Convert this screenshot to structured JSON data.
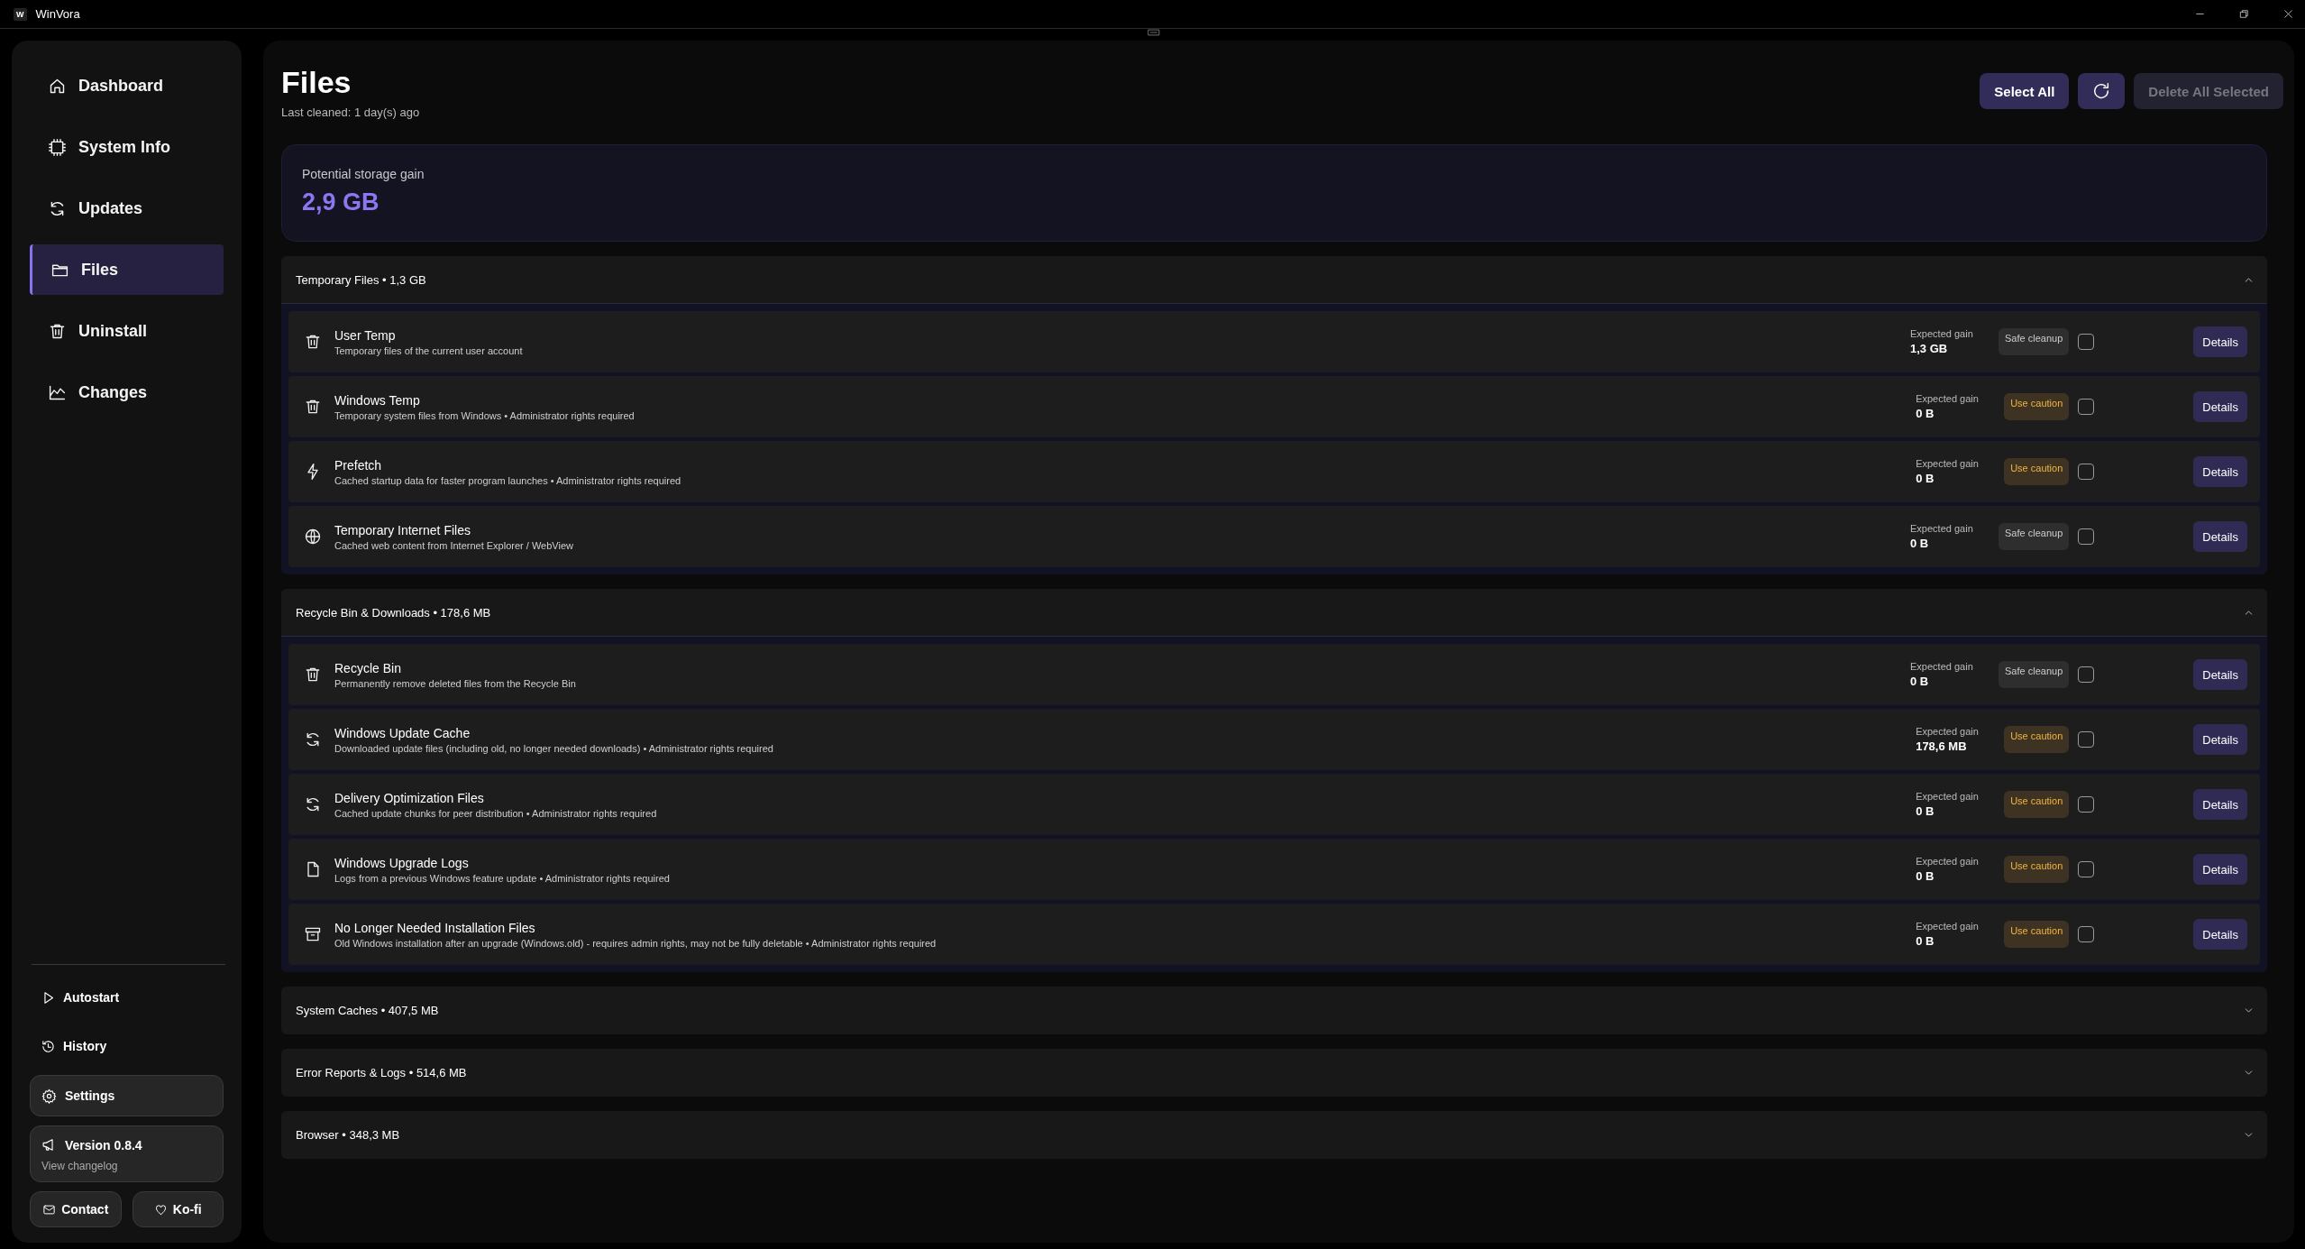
{
  "window": {
    "logo": "W",
    "title": "WinVora"
  },
  "sidebar": {
    "nav": [
      {
        "label": "Dashboard",
        "selected": false
      },
      {
        "label": "System Info",
        "selected": false
      },
      {
        "label": "Updates",
        "selected": false
      },
      {
        "label": "Files",
        "selected": true
      },
      {
        "label": "Uninstall",
        "selected": false
      },
      {
        "label": "Changes",
        "selected": false
      }
    ],
    "footer_links": [
      {
        "label": "Autostart"
      },
      {
        "label": "History"
      }
    ],
    "settings": {
      "label": "Settings"
    },
    "version": {
      "label": "Version 0.8.4",
      "link": "View changelog"
    },
    "buttons": [
      {
        "label": "Contact"
      },
      {
        "label": "Ko-fi"
      }
    ]
  },
  "page": {
    "title": "Files",
    "subtitle": "Last cleaned: 1 day(s) ago",
    "actions": [
      {
        "kind": "text",
        "label": "Select All",
        "disabled": false
      },
      {
        "kind": "refresh",
        "disabled": false
      },
      {
        "kind": "text",
        "label": "Delete All Selected",
        "disabled": true
      }
    ],
    "summary": {
      "label": "Potential storage gain",
      "value": "2,9 GB"
    },
    "sections": [
      {
        "title": "Temporary Files • 1,3 GB",
        "expanded": true,
        "items": [
          {
            "title": "User Temp",
            "description": "Temporary files of the current user account",
            "gain_label": "Expected gain",
            "gain": "1,3 GB",
            "badge": {
              "kind": "safe",
              "label": "Safe cleanup"
            },
            "checked": false,
            "button": "Details"
          },
          {
            "title": "Windows Temp",
            "description": "Temporary system files from Windows • Administrator rights required",
            "gain_label": "Expected gain",
            "gain": "0 B",
            "badge": {
              "kind": "caution",
              "label": "Use caution"
            },
            "checked": false,
            "button": "Details"
          },
          {
            "title": "Prefetch",
            "description": "Cached startup data for faster program launches • Administrator rights required",
            "gain_label": "Expected gain",
            "gain": "0 B",
            "badge": {
              "kind": "caution",
              "label": "Use caution"
            },
            "checked": false,
            "button": "Details"
          },
          {
            "title": "Temporary Internet Files",
            "description": "Cached web content from Internet Explorer / WebView",
            "gain_label": "Expected gain",
            "gain": "0 B",
            "badge": {
              "kind": "safe",
              "label": "Safe cleanup"
            },
            "checked": false,
            "button": "Details"
          }
        ]
      },
      {
        "title": "Recycle Bin & Downloads • 178,6 MB",
        "expanded": true,
        "items": [
          {
            "title": "Recycle Bin",
            "description": "Permanently remove deleted files from the Recycle Bin",
            "gain_label": "Expected gain",
            "gain": "0 B",
            "badge": {
              "kind": "safe",
              "label": "Safe cleanup"
            },
            "checked": false,
            "button": "Details"
          },
          {
            "title": "Windows Update Cache",
            "description": "Downloaded update files (including old, no longer needed downloads) • Administrator rights required",
            "gain_label": "Expected gain",
            "gain": "178,6 MB",
            "badge": {
              "kind": "caution",
              "label": "Use caution"
            },
            "checked": false,
            "button": "Details"
          },
          {
            "title": "Delivery Optimization Files",
            "description": "Cached update chunks for peer distribution • Administrator rights required",
            "gain_label": "Expected gain",
            "gain": "0 B",
            "badge": {
              "kind": "caution",
              "label": "Use caution"
            },
            "checked": false,
            "button": "Details"
          },
          {
            "title": "Windows Upgrade Logs",
            "description": "Logs from a previous Windows feature update • Administrator rights required",
            "gain_label": "Expected gain",
            "gain": "0 B",
            "badge": {
              "kind": "caution",
              "label": "Use caution"
            },
            "checked": false,
            "button": "Details"
          },
          {
            "title": "No Longer Needed Installation Files",
            "description": "Old Windows installation after an upgrade (Windows.old) - requires admin rights, may not be fully deletable • Administrator rights required",
            "gain_label": "Expected gain",
            "gain": "0 B",
            "badge": {
              "kind": "caution",
              "label": "Use caution"
            },
            "checked": false,
            "button": "Details"
          }
        ]
      },
      {
        "title": "System Caches • 407,5 MB",
        "expanded": false
      },
      {
        "title": "Error Reports & Logs • 514,6 MB",
        "expanded": false
      },
      {
        "title": "Browser • 348,3 MB",
        "expanded": false
      }
    ]
  }
}
